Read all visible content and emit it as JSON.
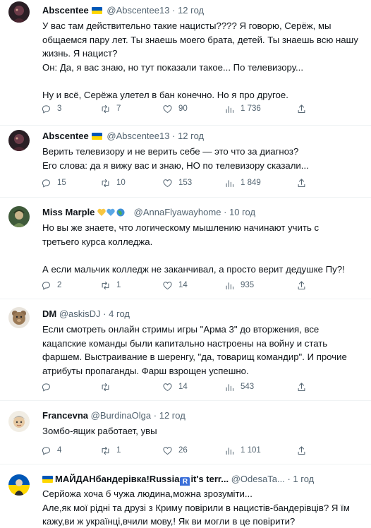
{
  "tweets": [
    {
      "name": "Abscentee",
      "handle": "@Abscentee13",
      "time": "12 год",
      "lines": [
        "У вас там действительно такие нацисты???? Я говорю, Серёж, мы",
        "общаемся пару лет. Ты знаешь моего брата, детей. Ты знаешь всю нашу",
        "жизнь. Я нацист?",
        "Он: Да, я вас знаю, но тут показали такое... По телевизору...",
        "",
        "Ну и всё, Серёжа улетел в бан конечно. Но я про другое."
      ],
      "replies": "3",
      "retweets": "7",
      "likes": "90",
      "views": "1 736"
    },
    {
      "name": "Abscentee",
      "handle": "@Abscentee13",
      "time": "12 год",
      "lines": [
        "Верить телевизору и не верить себе — это что за диагноз?",
        "Его слова: да я вижу вас и знаю, НО по телевизору сказали..."
      ],
      "replies": "15",
      "retweets": "10",
      "likes": "153",
      "views": "1 849"
    },
    {
      "name": "Miss Marple",
      "handle": "@AnnaFlyawayhome",
      "time": "10 год",
      "lines": [
        "Но вы же знаете, что логическому мышлению начинают учить с",
        "третьего курса колледжа.",
        "",
        "А если мальчик колледж не заканчивал, а просто верит дедушке Пу?!"
      ],
      "replies": "2",
      "retweets": "1",
      "likes": "14",
      "views": "935"
    },
    {
      "name": "DM",
      "handle": "@askisDJ",
      "time": "4 год",
      "lines": [
        "Если смотреть онлайн стримы игры \"Арма 3\" до вторжения, все",
        "кацапские команды были капитально настроены на войну и стать",
        "фаршем. Выстраивание в шеренгу, \"да, товарищ командир\". И прочие",
        "атрибуты пропаганды. Фарш взрощен успешно."
      ],
      "replies": "",
      "retweets": "",
      "likes": "14",
      "views": "543"
    },
    {
      "name": "Francevna",
      "handle": "@BurdinaOlga",
      "time": "12 год",
      "lines": [
        "Зомбо-ящик работает, увы"
      ],
      "replies": "4",
      "retweets": "1",
      "likes": "26",
      "views": "1 101"
    },
    {
      "name_pre": "МАЙДАНбандерівка!Russia",
      "name_badge": "R",
      "name_post": "it's terr...",
      "handle": "@OdesaTa...",
      "time": "1 год",
      "lines": [
        "Серйожа хоча б чужа людина,можна зрозуміти...",
        "Але,як мої рідні та друзі з Криму повірили в нацистів-бандерівців? Я їм",
        "кажу,ви ж українці,вчили мову,! Як ви могли в це повірити?"
      ]
    }
  ],
  "dot": "·"
}
